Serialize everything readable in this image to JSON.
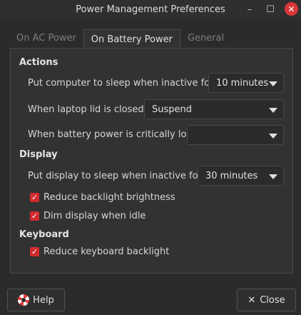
{
  "window": {
    "title": "Power Management Preferences",
    "controls": {
      "minimize": "–",
      "maximize": "☐",
      "close": "✕"
    }
  },
  "tabs": [
    {
      "label": "On AC Power",
      "active": false
    },
    {
      "label": "On Battery Power",
      "active": true
    },
    {
      "label": "General",
      "active": false
    }
  ],
  "actions": {
    "heading": "Actions",
    "sleep_label": "Put computer to sleep when inactive for:",
    "sleep_value": "10 minutes",
    "lid_label": "When laptop lid is closed:",
    "lid_value": "Suspend",
    "critical_label": "When battery power is critically low:",
    "critical_value": ""
  },
  "display": {
    "heading": "Display",
    "sleep_label": "Put display to sleep when inactive for:",
    "sleep_value": "30 minutes",
    "reduce_backlight_label": "Reduce backlight brightness",
    "reduce_backlight_checked": true,
    "dim_label": "Dim display when idle",
    "dim_checked": true
  },
  "keyboard": {
    "heading": "Keyboard",
    "reduce_kb_label": "Reduce keyboard backlight",
    "reduce_kb_checked": true
  },
  "footer": {
    "help_label": "Help",
    "close_label": "Close"
  },
  "colors": {
    "accent": "#d12b2e",
    "background": "#2b2b2b",
    "panel": "#323232"
  },
  "icons": {
    "help": "lifebuoy-icon",
    "close": "close-icon",
    "combo": "chevron-down-icon",
    "check": "checkmark-icon"
  }
}
